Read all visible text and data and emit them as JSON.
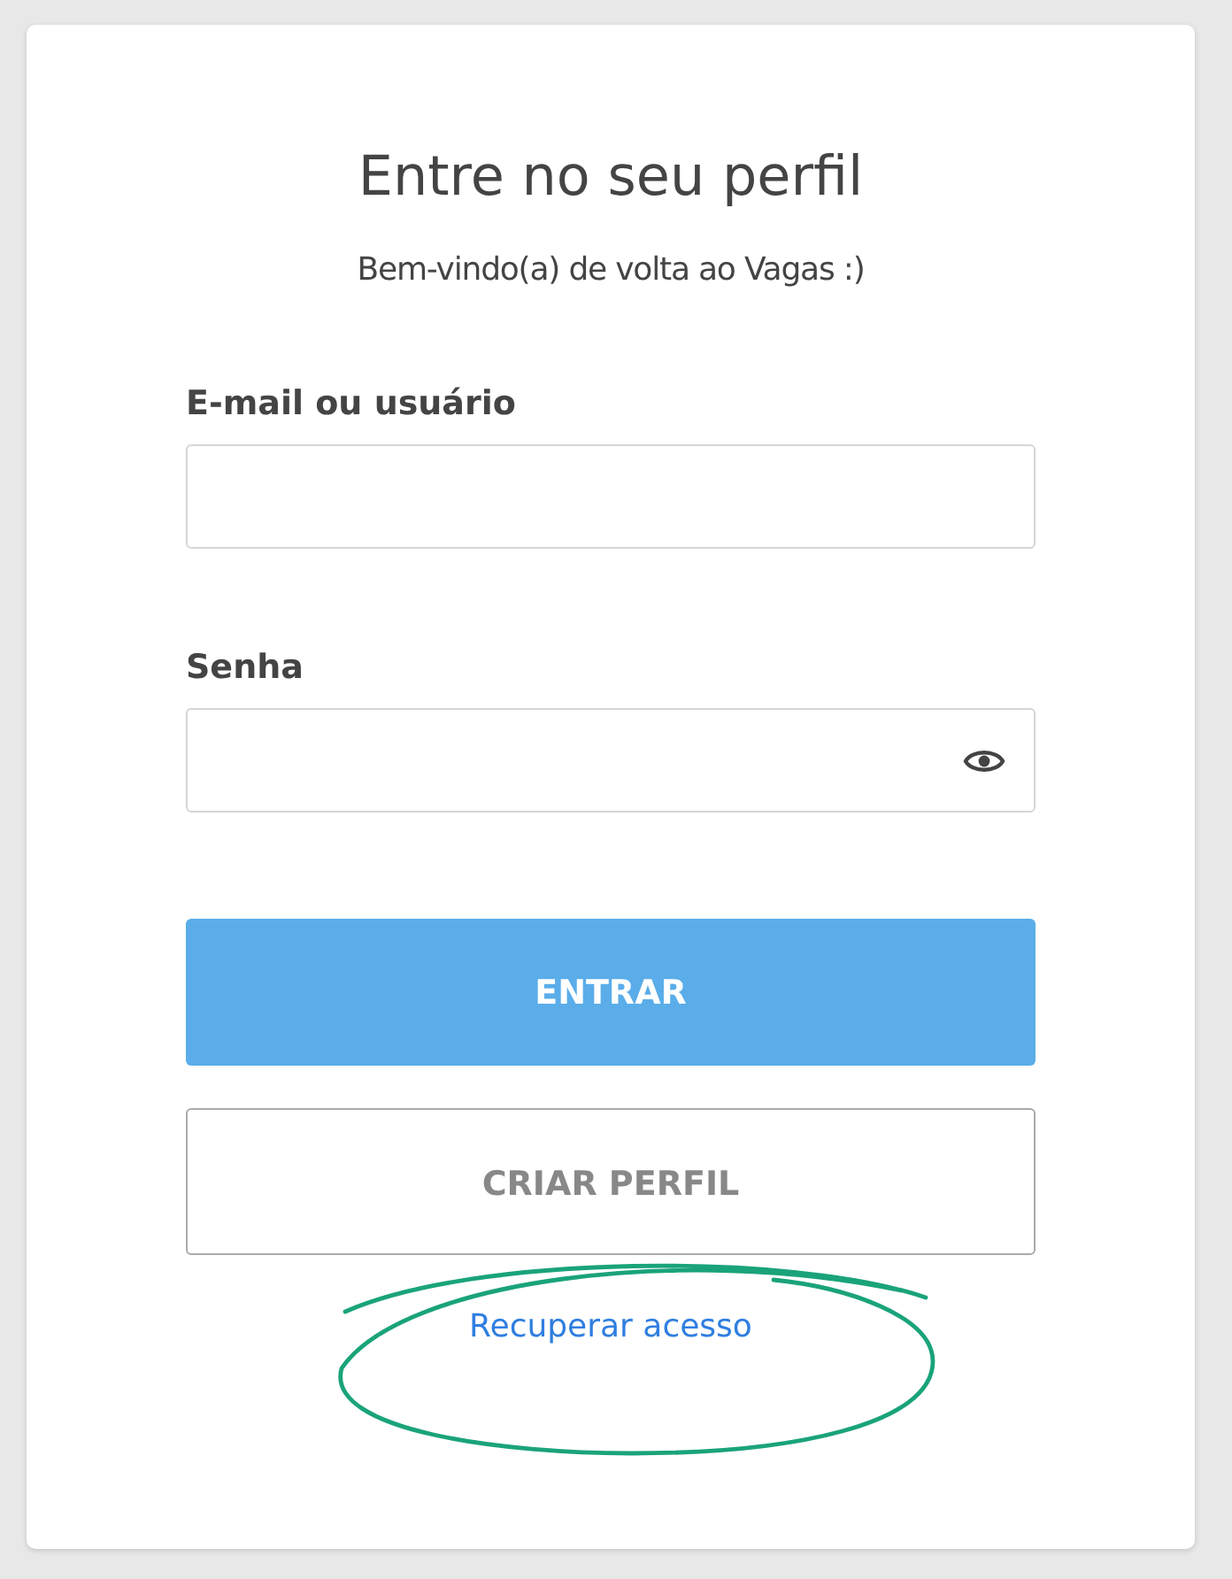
{
  "title": "Entre no seu perfil",
  "subtitle": "Bem-vindo(a) de volta ao Vagas :)",
  "fields": [
    {
      "label": "E-mail ou usuário",
      "kind": "text"
    },
    {
      "label": "Senha",
      "kind": "password"
    }
  ],
  "buttons": [
    {
      "label": "ENTRAR",
      "kind": "primary"
    },
    {
      "label": "CRIAR PERFIL",
      "kind": "secondary"
    }
  ],
  "link": "Recuperar acesso"
}
